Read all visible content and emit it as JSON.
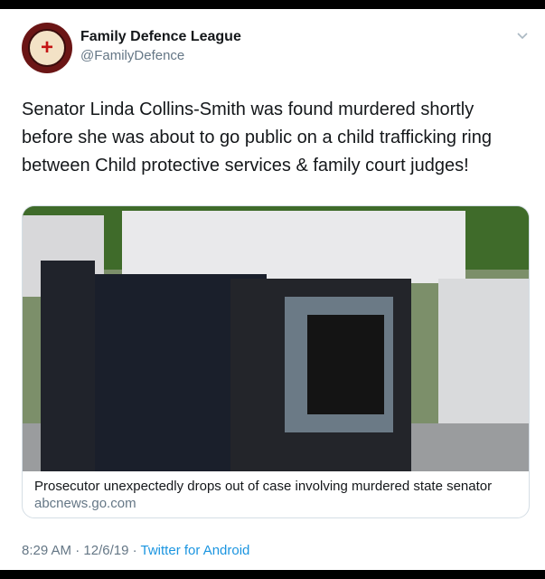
{
  "account": {
    "name": "Family Defence League",
    "handle": "@FamilyDefence",
    "avatar_label": "Family Defence League England"
  },
  "tweet": {
    "text": "Senator Linda Collins-Smith was found murdered shortly before she was about to go public on a child trafficking ring between Child protective services & family court judges!",
    "time": "8:29 AM",
    "date": "12/6/19",
    "separator": "·",
    "source": "Twitter for Android"
  },
  "card": {
    "title": "Prosecutor unexpectedly drops out of case involving murdered state senator",
    "domain": "abcnews.go.com"
  },
  "icons": {
    "more": "chevron-down-icon"
  },
  "colors": {
    "link": "#1b95e0",
    "secondary": "#657786",
    "text": "#14171a"
  }
}
